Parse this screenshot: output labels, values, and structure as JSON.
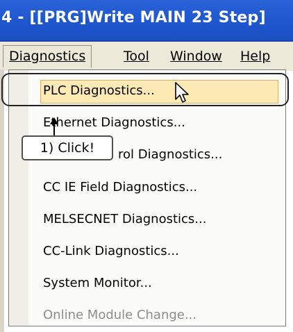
{
  "window": {
    "title": "4 - [[PRG]Write MAIN 23 Step]"
  },
  "menubar": {
    "items": [
      {
        "label": "Diagnostics",
        "active": true
      },
      {
        "label": "Tool",
        "active": false
      },
      {
        "label": "Window",
        "active": false
      },
      {
        "label": "Help",
        "active": false
      }
    ]
  },
  "dropdown": {
    "items": [
      {
        "label": "PLC Diagnostics...",
        "enabled": true,
        "highlighted": true
      },
      {
        "label": "Ethernet Diagnostics...",
        "enabled": true
      },
      {
        "label": "CC IE Control Diagnostics...",
        "enabled": true
      },
      {
        "label": "CC IE Field Diagnostics...",
        "enabled": true
      },
      {
        "label": "MELSECNET Diagnostics...",
        "enabled": true
      },
      {
        "label": "CC-Link Diagnostics...",
        "enabled": true
      },
      {
        "label": "System Monitor...",
        "enabled": true
      },
      {
        "label": "Online Module Change...",
        "enabled": false
      }
    ],
    "third_item_visible_part": "rol Diagnostics..."
  },
  "annotation": {
    "label": "1) Click!"
  },
  "icons": {
    "cursor": "arrow-cursor-icon",
    "pointer": "pointer-arrow-icon"
  },
  "colors": {
    "titlebar": "#1e56cf",
    "highlight": "#fde9b4",
    "menubar": "#ece9d8"
  }
}
